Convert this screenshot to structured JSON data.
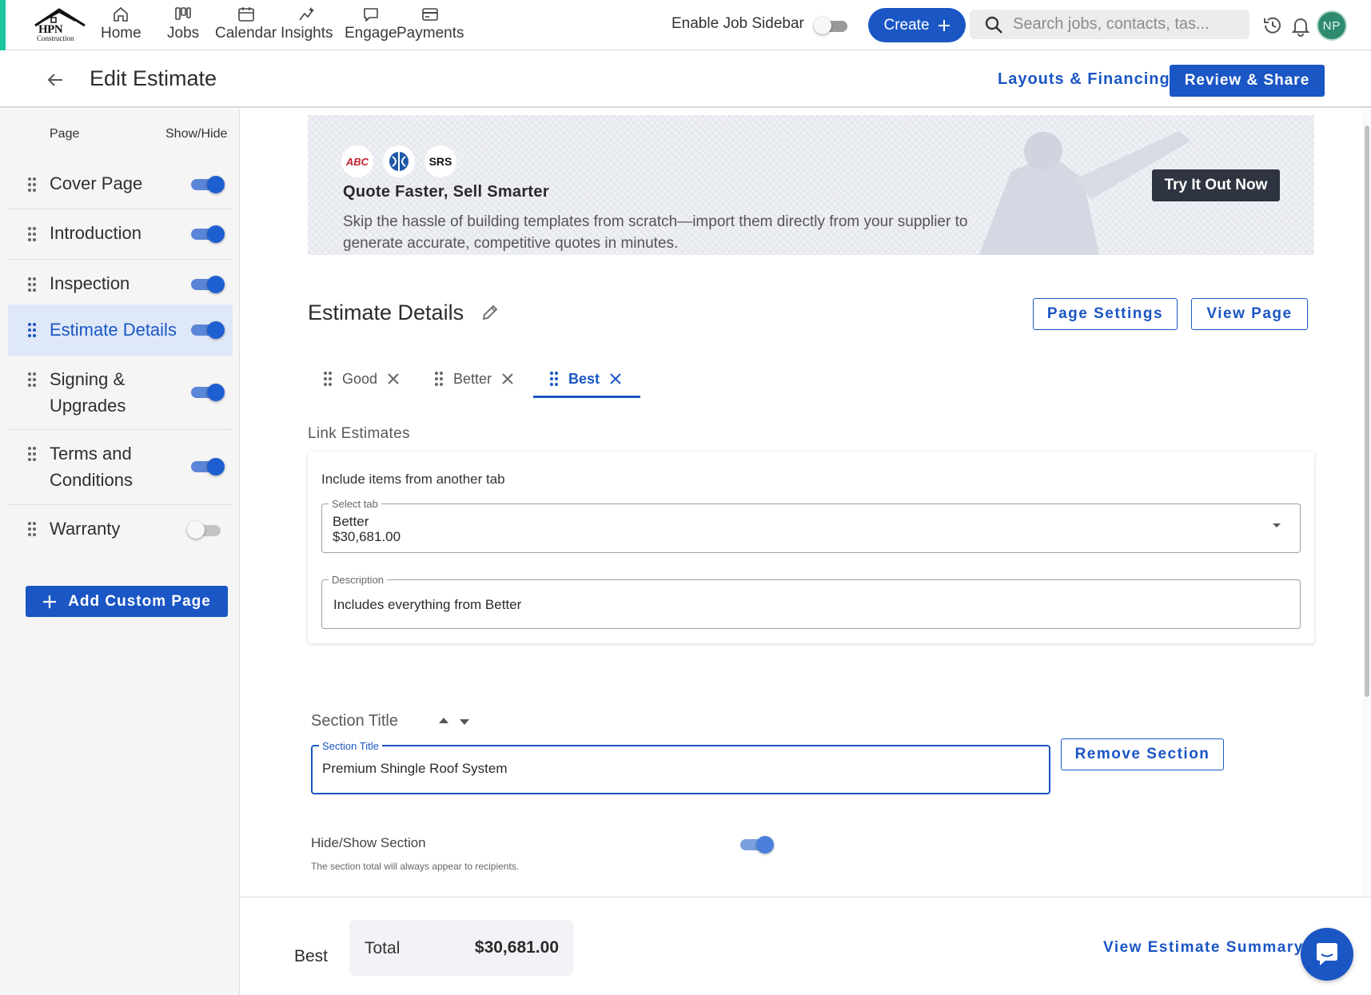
{
  "app": {
    "logo": {
      "name": "HPN",
      "sub": "Construction"
    },
    "nav": [
      {
        "label": "Home",
        "icon": "home-icon"
      },
      {
        "label": "Jobs",
        "icon": "jobs-icon"
      },
      {
        "label": "Calendar",
        "icon": "calendar-icon"
      },
      {
        "label": "Insights",
        "icon": "insights-icon"
      },
      {
        "label": "Engage",
        "icon": "chat-icon"
      },
      {
        "label": "Payments",
        "icon": "payments-icon"
      }
    ],
    "job_sidebar_label": "Enable Job Sidebar",
    "job_sidebar_enabled": false,
    "create_label": "Create",
    "search_placeholder": "Search jobs, contacts, tas...",
    "avatar_initials": "NP",
    "accent_color": "#1a56c4"
  },
  "header": {
    "title": "Edit Estimate",
    "layouts_label": "Layouts & Financing",
    "review_label": "Review & Share"
  },
  "sidebar": {
    "col_page": "Page",
    "col_show": "Show/Hide",
    "pages": [
      {
        "label": "Cover Page",
        "visible": true,
        "active": false
      },
      {
        "label": "Introduction",
        "visible": true,
        "active": false
      },
      {
        "label": "Inspection",
        "visible": true,
        "active": false
      },
      {
        "label": "Estimate Details",
        "visible": true,
        "active": true
      },
      {
        "label": "Signing & Upgrades",
        "visible": true,
        "active": false
      },
      {
        "label": "Terms and Conditions",
        "visible": true,
        "active": false
      },
      {
        "label": "Warranty",
        "visible": false,
        "active": false
      }
    ],
    "add_page_label": "Add Custom Page"
  },
  "promo": {
    "logos": [
      "ABC",
      "SRS"
    ],
    "title": "Quote Faster, Sell Smarter",
    "text": "Skip the hassle of building templates from scratch—import them directly from your supplier to generate accurate, competitive quotes in minutes.",
    "cta_label": "Try It Out Now"
  },
  "details": {
    "title": "Estimate Details",
    "page_settings_label": "Page Settings",
    "view_page_label": "View Page",
    "tabs": [
      {
        "label": "Good",
        "active": false
      },
      {
        "label": "Better",
        "active": false
      },
      {
        "label": "Best",
        "active": true
      }
    ],
    "link_estimates": {
      "heading": "Link Estimates",
      "card_title": "Include items from another tab",
      "select_tab_label": "Select tab",
      "select_tab_value": "Better",
      "select_tab_amount": "$30,681.00",
      "description_label": "Description",
      "description_value": "Includes everything from Better"
    },
    "section": {
      "title_label": "Section Title",
      "field_label": "Section Title",
      "field_value": "Premium Shingle Roof System",
      "remove_label": "Remove Section",
      "hide_show_label": "Hide/Show Section",
      "hide_show_enabled": true,
      "note": "The section total will always appear to recipients."
    }
  },
  "footer": {
    "tab_name": "Best",
    "total_label": "Total",
    "total_value": "$30,681.00",
    "summary_label": "View Estimate Summary"
  }
}
